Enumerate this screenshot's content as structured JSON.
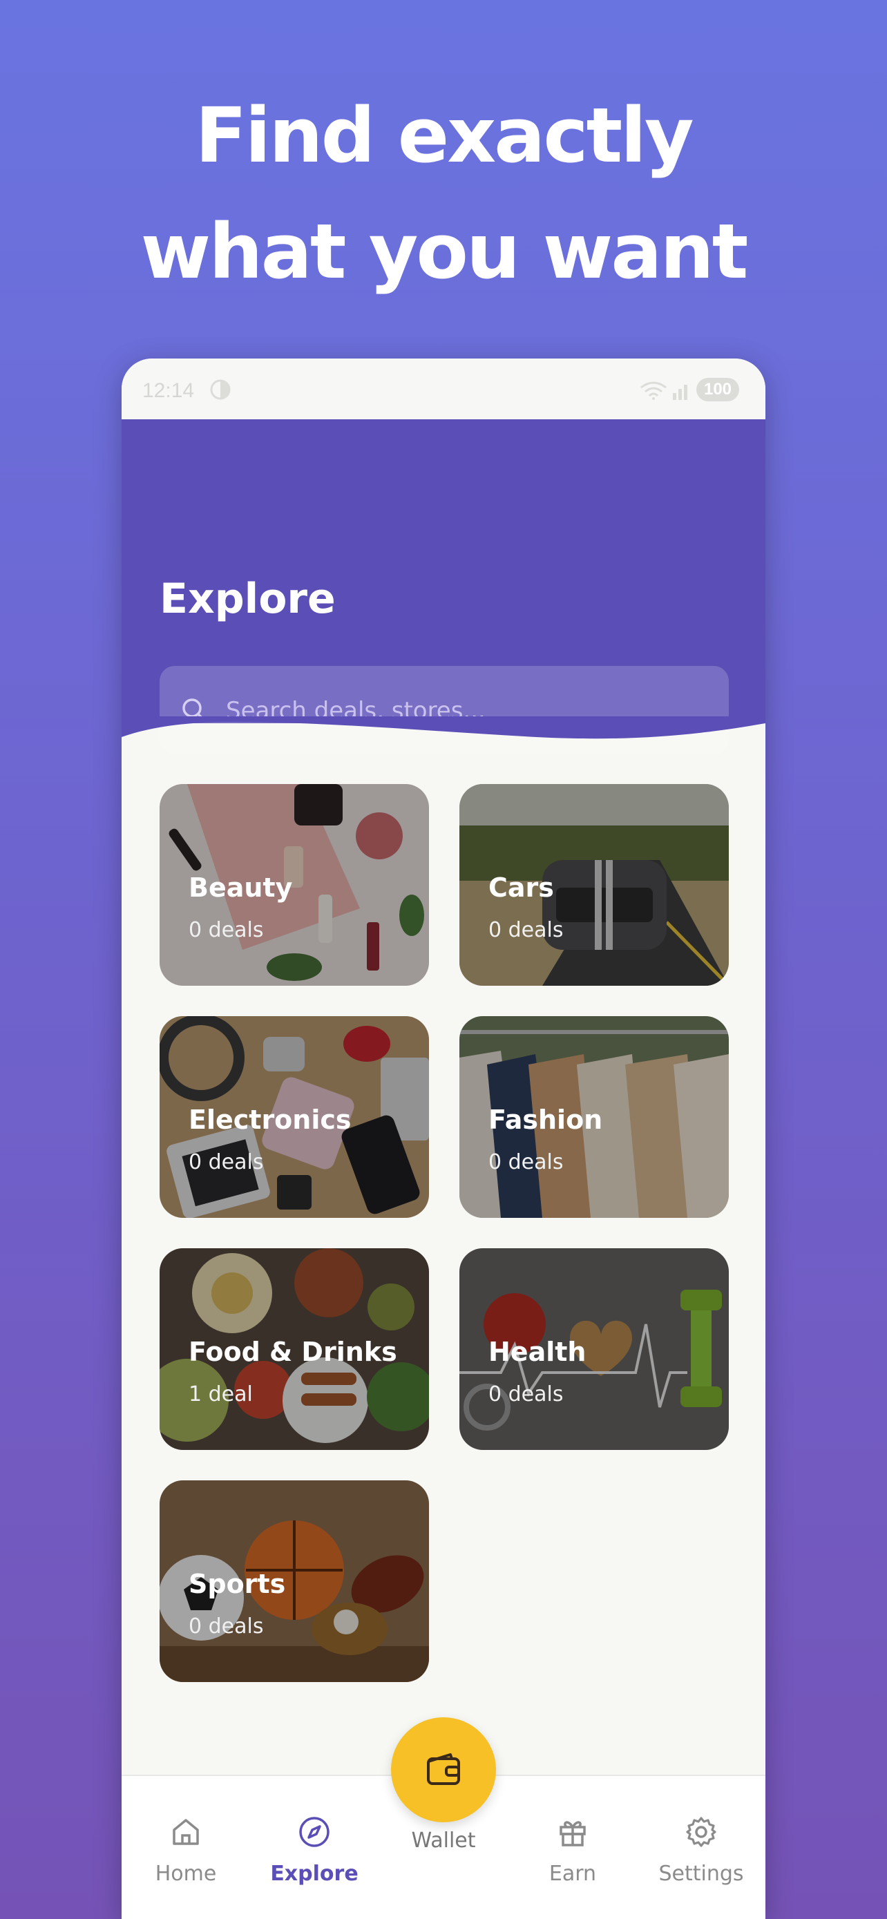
{
  "promo": {
    "headline_line1": "Find exactly",
    "headline_line2": "what you want"
  },
  "status_bar": {
    "time": "12:14",
    "battery": "100"
  },
  "header": {
    "title": "Explore",
    "search_placeholder": "Search deals, stores..."
  },
  "categories": [
    {
      "name": "Beauty",
      "deals": "0 deals"
    },
    {
      "name": "Cars",
      "deals": "0 deals"
    },
    {
      "name": "Electronics",
      "deals": "0 deals"
    },
    {
      "name": "Fashion",
      "deals": "0 deals"
    },
    {
      "name": "Food & Drinks",
      "deals": "1 deal"
    },
    {
      "name": "Health",
      "deals": "0 deals"
    },
    {
      "name": "Sports",
      "deals": "0 deals"
    }
  ],
  "bottom_nav": {
    "home": "Home",
    "explore": "Explore",
    "wallet": "Wallet",
    "earn": "Earn",
    "settings": "Settings",
    "active": "Explore"
  },
  "colors": {
    "brand_purple": "#5b4fb7",
    "wallet_yellow": "#f6c026",
    "background_top": "#6a74e0",
    "background_bottom": "#7553b6"
  },
  "icons": {
    "home": "home-icon",
    "explore": "compass-icon",
    "wallet": "wallet-icon",
    "earn": "gift-icon",
    "settings": "gear-icon",
    "search": "search-icon"
  }
}
